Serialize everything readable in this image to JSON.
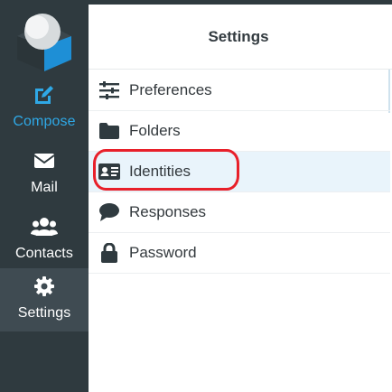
{
  "sidebar": {
    "items": [
      {
        "label": "Compose",
        "icon": "compose-icon"
      },
      {
        "label": "Mail",
        "icon": "envelope-icon"
      },
      {
        "label": "Contacts",
        "icon": "users-icon"
      },
      {
        "label": "Settings",
        "icon": "gear-icon"
      }
    ],
    "active": "Settings"
  },
  "panel": {
    "title": "Settings",
    "items": [
      {
        "label": "Preferences",
        "icon": "sliders-icon"
      },
      {
        "label": "Folders",
        "icon": "folder-icon"
      },
      {
        "label": "Identities",
        "icon": "id-card-icon"
      },
      {
        "label": "Responses",
        "icon": "speech-bubble-icon"
      },
      {
        "label": "Password",
        "icon": "lock-icon"
      }
    ],
    "selected": "Identities"
  },
  "colors": {
    "sidebar_bg": "#2f3a3f",
    "accent": "#2fa8e6",
    "selected_row": "#e9f4fb",
    "annotation": "#e8202a"
  }
}
